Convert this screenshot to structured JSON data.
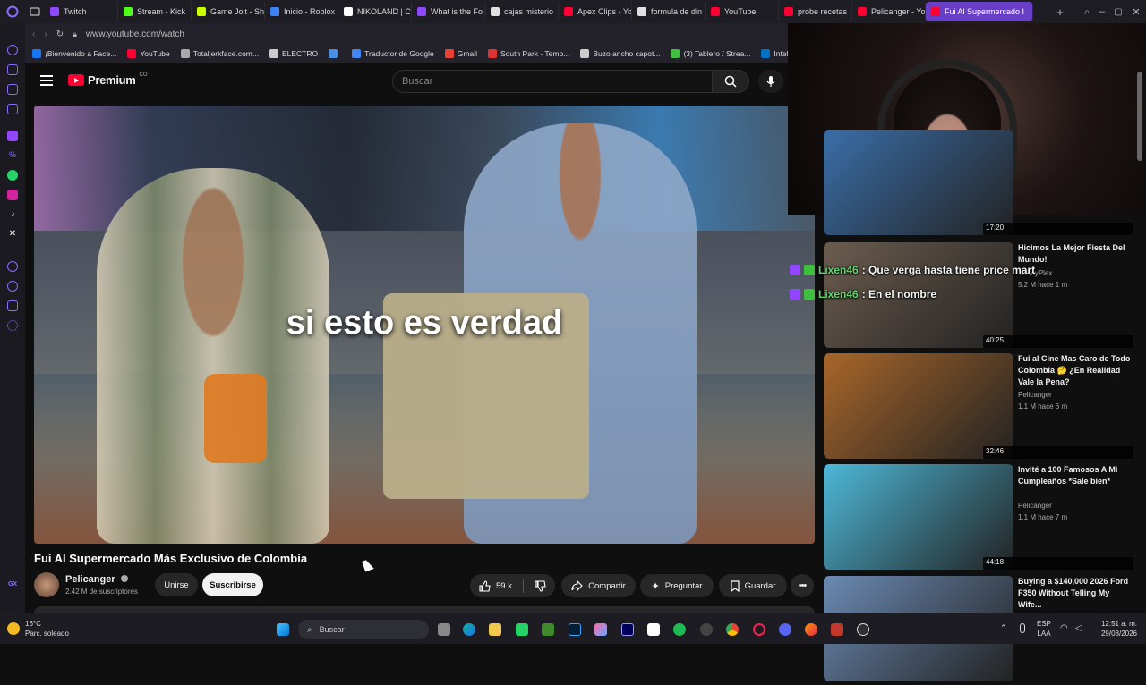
{
  "tabs": [
    {
      "label": "Twitch",
      "color": "#9147ff"
    },
    {
      "label": "Stream - Kick",
      "color": "#53fc18"
    },
    {
      "label": "Game Jolt - Sh",
      "color": "#ccff00"
    },
    {
      "label": "Inicio - Roblox",
      "color": "#3b82f6"
    },
    {
      "label": "NIKOLAND | C",
      "color": "#ffffff"
    },
    {
      "label": "What is the Fo",
      "color": "#9147ff"
    },
    {
      "label": "cajas misterio",
      "color": "#e0e0e0"
    },
    {
      "label": "Apex Clips - Yo",
      "color": "#ff0033"
    },
    {
      "label": "formula de din",
      "color": "#e0e0e0"
    },
    {
      "label": "YouTube",
      "color": "#ff0033"
    },
    {
      "label": "probe recetas",
      "color": "#ff0033"
    },
    {
      "label": "Pelicanger - Yo",
      "color": "#ff0033"
    },
    {
      "label": "Fui Al Supermercado I",
      "color": "#ff0033"
    }
  ],
  "url": "www.youtube.com/watch",
  "bookmarks": [
    "¡Bienvenido a Face...",
    "YouTube",
    "Totaljerkface.com...",
    "ELECTRO",
    "",
    "Traductor de Google",
    "Gmail",
    "South Park - Temp...",
    "Buzo ancho capot...",
    "(3) Tablero / Strea...",
    "Intel Play"
  ],
  "yt": {
    "logo": "Premium",
    "logo_country": "CO",
    "search_placeholder": "Buscar"
  },
  "video": {
    "caption": "si esto es verdad",
    "title": "Fui Al Supermercado Más Exclusivo de Colombia",
    "channel": "Pelicanger",
    "subscribers": "2.42 M de suscriptores",
    "join": "Unirse",
    "subscribe": "Suscribirse",
    "likes": "59 k",
    "share": "Compartir",
    "ask": "Preguntar",
    "save": "Guardar"
  },
  "recommendations": [
    {
      "title": "",
      "channel": "",
      "meta": "",
      "duration": "17:20",
      "thumb": "#3a6ea8"
    },
    {
      "title": "Hicimos La Mejor Fiesta Del Mundo!",
      "channel": "YoSoyPlex",
      "meta": "5.2 M  hace 1 m",
      "duration": "40:25",
      "thumb": "#6b5c4e"
    },
    {
      "title": "Fui al Cine Mas Caro de Todo Colombia 🤔 ¿En Realidad Vale la Pena?",
      "channel": "Pelicanger",
      "meta": "1.1 M  hace 6 m",
      "duration": "32:46",
      "thumb": "#a8662a"
    },
    {
      "title": "Invité a 100 Famosos A Mi Cumpleaños *Sale bien*",
      "channel": "Pelicanger",
      "meta": "1.1 M  hace 7 m",
      "duration": "44:18",
      "thumb": "#4db8d8"
    },
    {
      "title": "Buying a $140,000 2026 Ford F350 Without Telling My Wife...",
      "channel": "",
      "meta": "",
      "duration": "",
      "thumb": "#6b8ab3"
    }
  ],
  "chat": [
    {
      "user": "Lixen46",
      "message": ": Que verga hasta tiene price mart"
    },
    {
      "user": "Lixen46",
      "message": ": En el nombre"
    }
  ],
  "taskbar": {
    "search": "Buscar",
    "temp": "16°C",
    "weather": "Parc. soleado",
    "lang1": "ESP",
    "lang2": "LAA",
    "time": "12:51 a. m.",
    "date": "29/08/2026"
  }
}
